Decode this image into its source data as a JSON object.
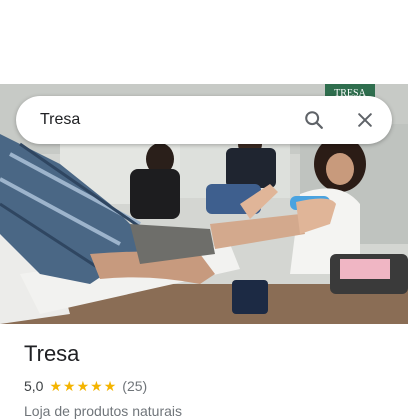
{
  "search": {
    "query": "Tresa"
  },
  "photo": {
    "sign_text": "TRESA"
  },
  "place": {
    "name": "Tresa",
    "rating": "5,0",
    "stars": 5,
    "review_count": "(25)",
    "category": "Loja de produtos naturais"
  },
  "colors": {
    "star": "#f4b400",
    "text_secondary": "#70757a",
    "title": "#202124"
  },
  "icons": {
    "search": "search-icon",
    "close": "close-icon",
    "star": "star-icon"
  }
}
